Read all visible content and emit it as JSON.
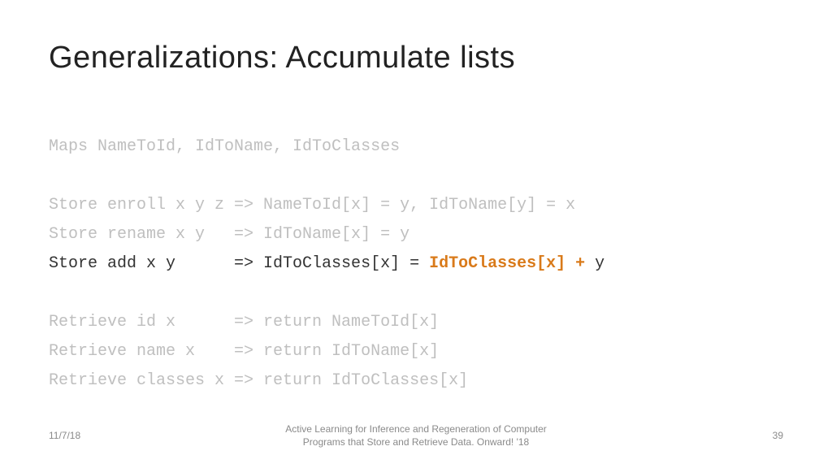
{
  "title": "Generalizations: Accumulate lists",
  "code": {
    "maps": "Maps NameToId, IdToName, IdToClasses",
    "store_enroll": "Store enroll x y z => NameToId[x] = y, IdToName[y] = x",
    "store_rename": "Store rename x y   => IdToName[x] = y",
    "store_add_left": "Store add x y      => IdToClasses[x] = ",
    "store_add_highlight": "IdToClasses[x] + ",
    "store_add_tail": "y",
    "retrieve_id": "Retrieve id x      => return NameToId[x]",
    "retrieve_name": "Retrieve name x    => return IdToName[x]",
    "retrieve_classes": "Retrieve classes x => return IdToClasses[x]"
  },
  "footer": {
    "date": "11/7/18",
    "center_line1": "Active Learning for Inference and Regeneration of Computer",
    "center_line2": "Programs that Store and Retrieve Data. Onward! '18",
    "page": "39"
  }
}
